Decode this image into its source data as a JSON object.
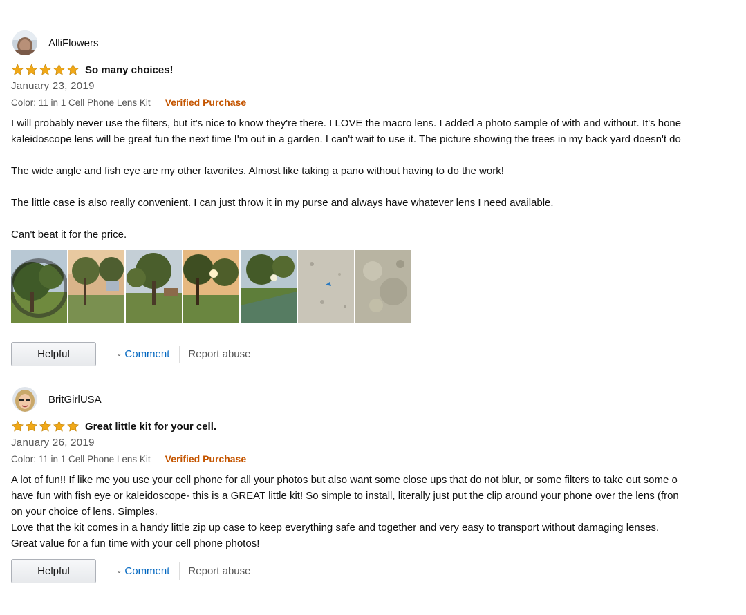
{
  "colors": {
    "star": "#f0a818",
    "star_stroke": "#c88a10",
    "verified": "#c45500",
    "link": "#0066c0"
  },
  "reviews": [
    {
      "username": "AlliFlowers",
      "rating": 5,
      "title": "So many choices!",
      "date": "January 23, 2019",
      "color_option": "Color: 11 in 1 Cell Phone Lens Kit",
      "verified": "Verified Purchase",
      "body": [
        "I will probably never use the filters, but it's nice to know they're there. I LOVE the macro lens. I added a photo sample of with and without. It's hone",
        "kaleidoscope lens will be great fun the next time I'm out in a garden. I can't wait to use it. The picture showing the trees in my back yard doesn't do",
        "The wide angle and fish eye are my other favorites. Almost like taking a pano without having to do the work!",
        "The little case is also really convenient. I can just throw it in my purse and always have whatever lens I need available.",
        "Can't beat it for the price."
      ],
      "photo_count": 7,
      "helpful_label": "Helpful",
      "comment_label": "Comment",
      "report_label": "Report abuse"
    },
    {
      "username": "BritGirlUSA",
      "rating": 5,
      "title": "Great little kit for your cell.",
      "date": "January 26, 2019",
      "color_option": "Color: 11 in 1 Cell Phone Lens Kit",
      "verified": "Verified Purchase",
      "body": [
        "A lot of fun!! If like me you use your cell phone for all your photos but also want some close ups that do not blur, or some filters to take out some o",
        "have fun with fish eye or kaleidoscope- this is a GREAT little kit! So simple to install, literally just put the clip around your phone over the lens (fron",
        "on your choice of lens. Simples.",
        "Love that the kit comes in a handy little zip up case to keep everything safe and together and very easy to transport without damaging lenses.",
        "Great value for a fun time with your cell phone photos!"
      ],
      "helpful_label": "Helpful",
      "comment_label": "Comment",
      "report_label": "Report abuse"
    }
  ],
  "icons": {
    "star": "star-icon",
    "chevron": "chevron-down-icon",
    "avatar": "avatar"
  }
}
